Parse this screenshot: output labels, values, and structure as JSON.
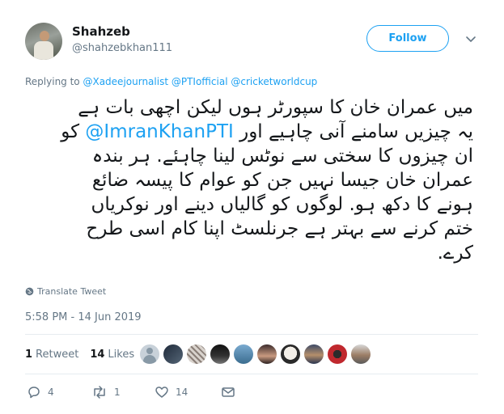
{
  "author": {
    "name": "Shahzeb",
    "handle": "@shahzebkhan111"
  },
  "follow_label": "Follow",
  "reply_context": {
    "prefix": "Replying to",
    "mentions": [
      "@Xadeejournalist",
      "@PTIofficial",
      "@cricketworldcup"
    ]
  },
  "tweet": {
    "line1": "میں عمران خان کا سپورٹر ہوں لیکن اچھی بات ہے",
    "line2_before": "یہ چیزیں سامنے آنی چاہیے اور",
    "line2_mention": "@ImranKhanPTI",
    "line2_after": "کو",
    "line3": "ان چیزوں کا سختی سے نوٹس لینا چاہئے. ہر بندہ",
    "line4": "عمران خان جیسا نہیں جن کو عوام کا پیسہ ضائع",
    "line5": "ہونے کا دکھ ہو. لوگوں کو گالیاں دینے اور نوکریاں",
    "line6": "ختم کرنے سے بہتر ہے جرنلسٹ اپنا کام اسی طرح",
    "line7": "کرے."
  },
  "translate_label": "Translate Tweet",
  "timestamp": "5:58 PM - 14 Jun 2019",
  "stats": {
    "retweets_count": "1",
    "retweets_label": "Retweet",
    "likes_count": "14",
    "likes_label": "Likes"
  },
  "actions": {
    "reply_count": "4",
    "retweet_count": "1",
    "like_count": "14"
  },
  "colors": {
    "accent": "#1da1f2",
    "muted": "#657786",
    "text": "#14171a",
    "divider": "#e6ecf0"
  },
  "icons": [
    "caret-down-icon",
    "globe-icon",
    "reply-icon",
    "retweet-icon",
    "heart-icon",
    "message-icon"
  ]
}
